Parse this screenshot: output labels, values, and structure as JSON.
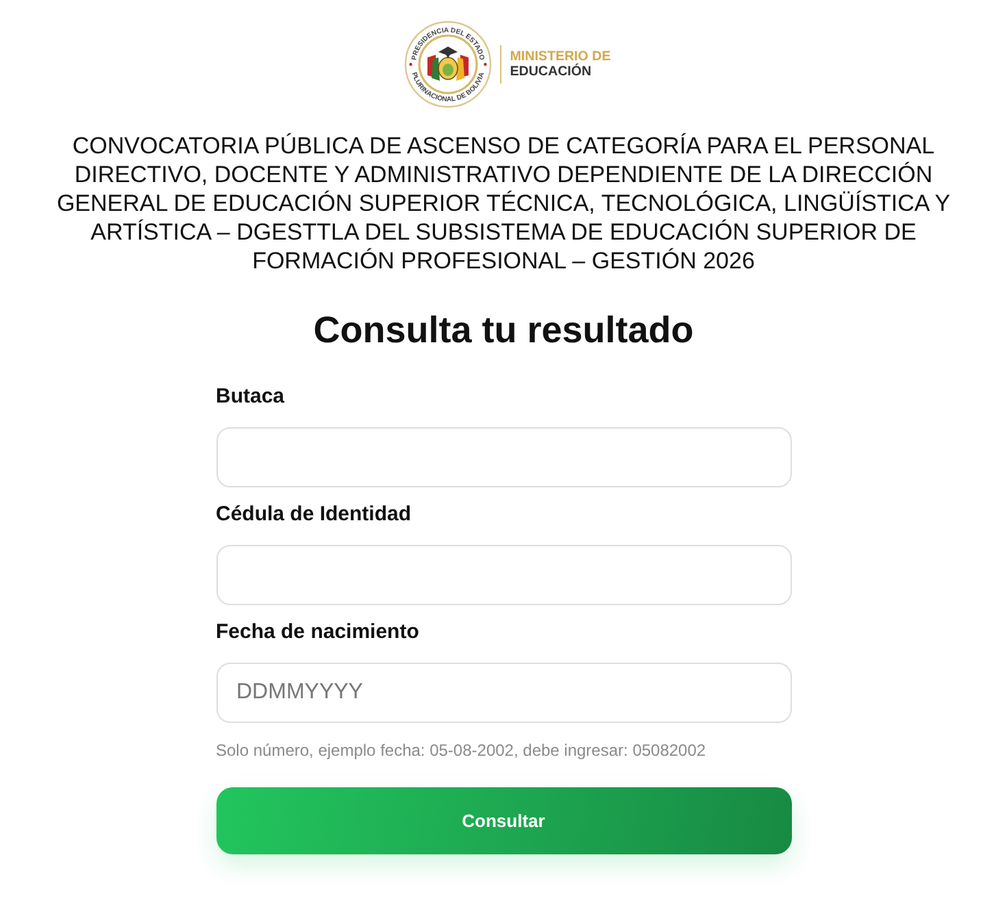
{
  "logo": {
    "seal_top": "PRESIDENCIA DEL ESTADO",
    "seal_bottom": "PLURINACIONAL DE BOLIVIA",
    "line_1": "MINISTERIO DE",
    "line_2": "EDUCACIÓN"
  },
  "announcement": "CONVOCATORIA PÚBLICA DE ASCENSO DE CATEGORÍA PARA EL PERSONAL DIRECTIVO, DOCENTE Y ADMINISTRATIVO DEPENDIENTE DE LA DIRECCIÓN GENERAL DE EDUCACIÓN SUPERIOR TÉCNICA, TECNOLÓGICA, LINGÜÍSTICA Y ARTÍSTICA – DGESTTLA DEL SUBSISTEMA DE EDUCACIÓN SUPERIOR DE FORMACIÓN PROFESIONAL – GESTIÓN 2026",
  "title": "Consulta tu resultado",
  "fields": [
    {
      "label": "Butaca"
    },
    {
      "label": "Cédula de Identidad"
    },
    {
      "label": "Fecha de nacimiento",
      "placeholder": "DDMMYYYY"
    }
  ],
  "hint": "Solo número, ejemplo fecha: 05-08-2002, debe ingresar: 05082002",
  "submit_button": "Consultar"
}
